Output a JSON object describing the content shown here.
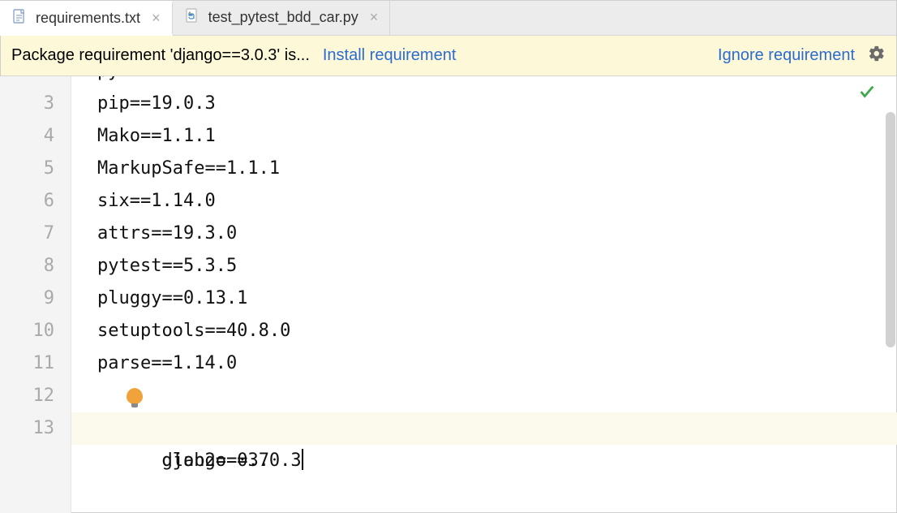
{
  "tabs": [
    {
      "label": "requirements.txt",
      "icon": "text-file-icon",
      "active": true
    },
    {
      "label": "test_pytest_bdd_car.py",
      "icon": "python-file-icon",
      "active": false
    }
  ],
  "banner": {
    "message": "Package requirement 'django==3.0.3' is...",
    "install_label": "Install requirement",
    "ignore_label": "Ignore requirement"
  },
  "editor": {
    "partial_top_line": "py  ....",
    "lines": [
      {
        "num": "3",
        "text": "pip==19.0.3"
      },
      {
        "num": "4",
        "text": "Mako==1.1.1"
      },
      {
        "num": "5",
        "text": "MarkupSafe==1.1.1"
      },
      {
        "num": "6",
        "text": "six==1.14.0"
      },
      {
        "num": "7",
        "text": "attrs==19.3.0"
      },
      {
        "num": "8",
        "text": "pytest==5.3.5"
      },
      {
        "num": "9",
        "text": "pluggy==0.13.1"
      },
      {
        "num": "10",
        "text": "setuptools==40.8.0"
      },
      {
        "num": "11",
        "text": "parse==1.14.0"
      },
      {
        "num": "12",
        "text": "glob2==0.7",
        "bulb": true
      },
      {
        "num": "13",
        "text": "django==3.0.3",
        "current": true,
        "caret": true
      }
    ]
  }
}
